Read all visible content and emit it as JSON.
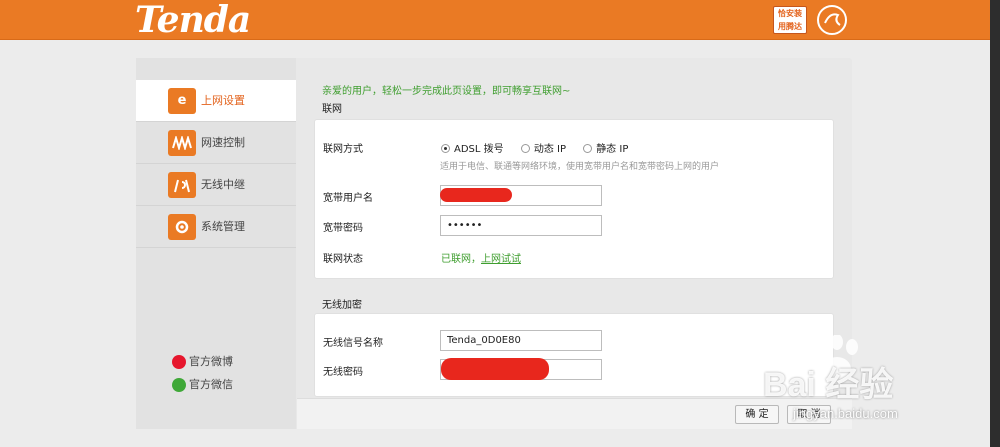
{
  "header": {
    "logo": "Tenda",
    "badge_line1": "恰安装",
    "badge_line2": "用腾达"
  },
  "sidebar": {
    "items": [
      {
        "label": "上网设置",
        "icon": "internet-icon",
        "active": true
      },
      {
        "label": "网速控制",
        "icon": "speed-control-icon",
        "active": false
      },
      {
        "label": "无线中继",
        "icon": "wireless-relay-icon",
        "active": false
      },
      {
        "label": "系统管理",
        "icon": "system-settings-icon",
        "active": false
      }
    ],
    "social": [
      {
        "label": "官方微博",
        "icon": "weibo-icon"
      },
      {
        "label": "官方微信",
        "icon": "wechat-icon"
      }
    ]
  },
  "content": {
    "intro": "亲爱的用户，轻松一步完成此页设置，即可畅享互联网~",
    "network": {
      "section_title": "联网",
      "mode_label": "联网方式",
      "mode_options": [
        "ADSL 拨号",
        "动态 IP",
        "静态 IP"
      ],
      "mode_selected": "ADSL 拨号",
      "hint": "适用于电信、联通等网络环境，使用宽带用户名和宽带密码上网的用户",
      "username_label": "宽带用户名",
      "username_value": "",
      "password_label": "宽带密码",
      "password_value": "••••••",
      "status_label": "联网状态",
      "status_text": "已联网，",
      "status_link": "上网试试"
    },
    "wireless": {
      "section_title": "无线加密",
      "ssid_label": "无线信号名称",
      "ssid_value": "Tenda_0D0E80",
      "password_label": "无线密码",
      "password_value": ""
    }
  },
  "buttons": {
    "confirm": "确 定",
    "cancel": "取 消"
  },
  "watermark": {
    "text": "Bai 经验",
    "url": "jingyan.baidu.com"
  },
  "colors": {
    "brand_orange": "#ea7a24",
    "success_green": "#3f9e2f",
    "redaction_red": "#e8271d"
  }
}
